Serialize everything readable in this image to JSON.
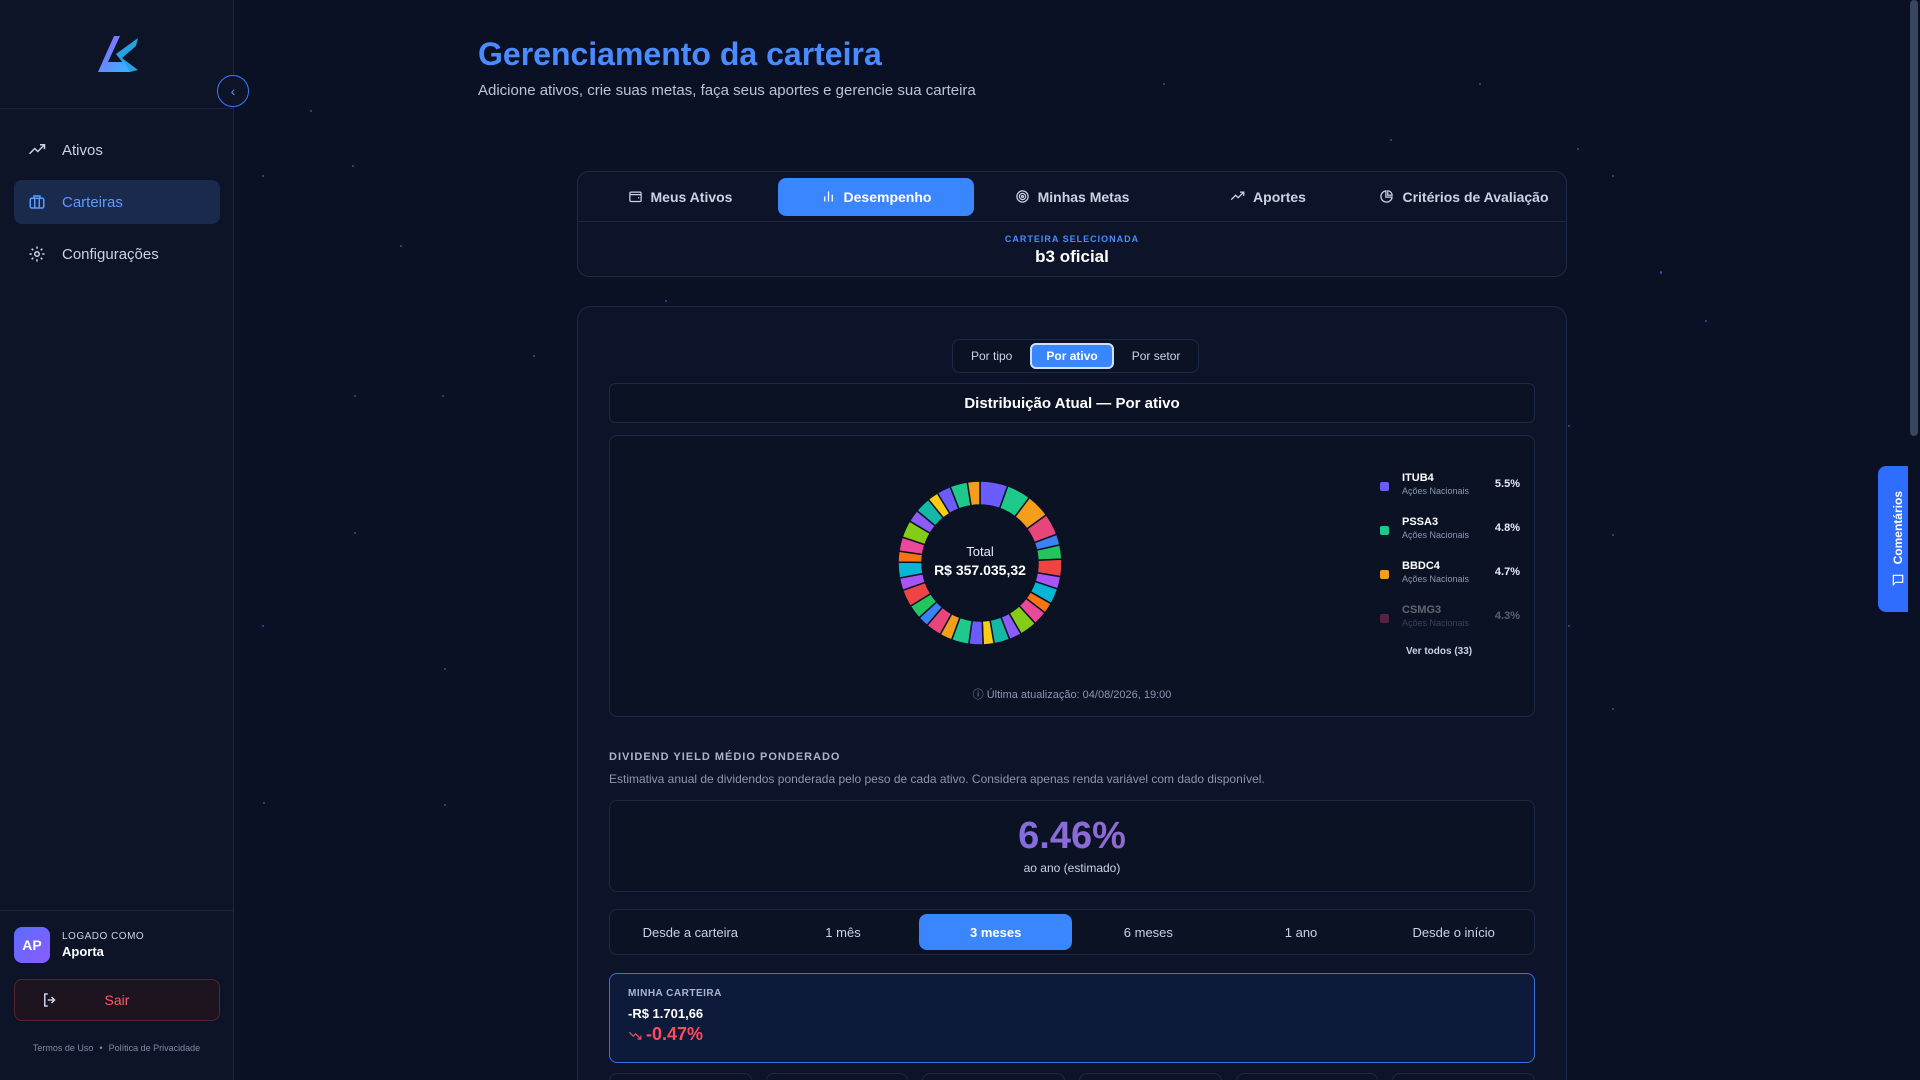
{
  "sidebar": {
    "items": [
      {
        "label": "Ativos",
        "icon": "trending-up-icon"
      },
      {
        "label": "Carteiras",
        "icon": "briefcase-icon"
      },
      {
        "label": "Configurações",
        "icon": "gear-icon"
      }
    ],
    "logged_label": "LOGADO COMO",
    "user_initials": "AP",
    "user_name": "Aporta",
    "logout_label": "Sair",
    "terms": "Termos de Uso",
    "separator": "•",
    "privacy": "Política de Privacidade"
  },
  "header": {
    "title": "Gerenciamento da carteira",
    "subtitle": "Adicione ativos, crie suas metas, faça seus aportes e gerencie sua carteira"
  },
  "tabs": [
    {
      "label": "Meus Ativos",
      "icon": "wallet-icon"
    },
    {
      "label": "Desempenho",
      "icon": "bar-chart-icon"
    },
    {
      "label": "Minhas Metas",
      "icon": "target-icon"
    },
    {
      "label": "Aportes",
      "icon": "trending-up-icon"
    },
    {
      "label": "Critérios de Avaliação",
      "icon": "pie-chart-icon"
    }
  ],
  "selected_wallet": {
    "label": "CARTEIRA SELECIONADA",
    "name": "b3 oficial"
  },
  "distribution": {
    "segments": [
      "Por tipo",
      "Por ativo",
      "Por setor"
    ],
    "title": "Distribuição Atual — Por ativo",
    "total_label": "Total",
    "total_value": "R$ 357.035,32",
    "see_all": "Ver todos (33)",
    "updated": "Última atualização: 04/08/2026, 19:00"
  },
  "chart_data": {
    "type": "pie",
    "slices": [
      {
        "label": "ITUB4",
        "sub": "Ações Nacionais",
        "value": 5.5,
        "display": "5.5%",
        "color": "#6b5cff"
      },
      {
        "label": "PSSA3",
        "sub": "Ações Nacionais",
        "value": 4.8,
        "display": "4.8%",
        "color": "#1fc98b"
      },
      {
        "label": "BBDC4",
        "sub": "Ações Nacionais",
        "value": 4.7,
        "display": "4.7%",
        "color": "#f59e1b"
      },
      {
        "label": "CSMG3",
        "sub": "Ações Nacionais",
        "value": 4.3,
        "display": "4.3%",
        "color": "#e8457a"
      }
    ],
    "other_count": 29,
    "palette": [
      "#6b5cff",
      "#1fc98b",
      "#f59e1b",
      "#e8457a",
      "#3b82f6",
      "#22c55e",
      "#ef4444",
      "#a855f7",
      "#06b6d4",
      "#f97316",
      "#ec4899",
      "#84cc16",
      "#8b5cf6",
      "#14b8a6",
      "#facc15"
    ]
  },
  "dividend": {
    "title": "DIVIDEND YIELD MÉDIO PONDERADO",
    "description": "Estimativa anual de dividendos ponderada pelo peso de cada ativo. Considera apenas renda variável com dado disponível.",
    "value": "6.46%",
    "sub": "ao ano (estimado)"
  },
  "periods": [
    "Desde a carteira",
    "1 mês",
    "3 meses",
    "6 meses",
    "1 ano",
    "Desde o início"
  ],
  "performance": {
    "label": "MINHA CARTEIRA",
    "amount": "-R$ 1.701,66",
    "pct": "-0.47%"
  },
  "feedback": {
    "label": "Comentários"
  }
}
